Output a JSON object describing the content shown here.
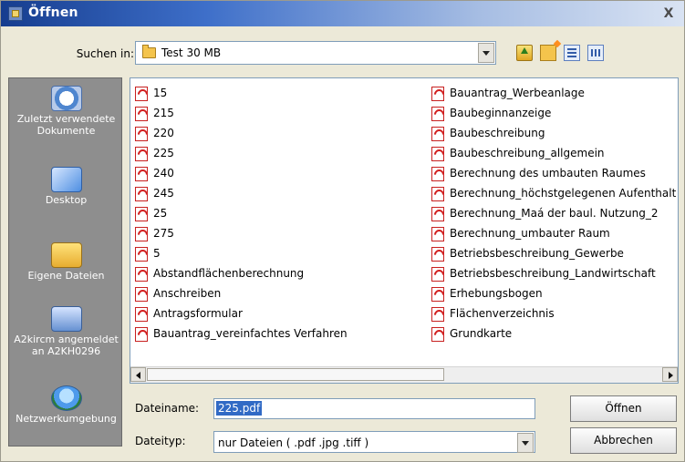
{
  "window": {
    "title": "Öffnen",
    "close": "X"
  },
  "lookin": {
    "label": "Suchen in:",
    "value": "Test 30 MB"
  },
  "places": [
    {
      "label": "Zuletzt verwendete Dokumente",
      "icon": "recent-documents-icon"
    },
    {
      "label": "Desktop",
      "icon": "desktop-icon"
    },
    {
      "label": "Eigene Dateien",
      "icon": "my-documents-icon"
    },
    {
      "label": "A2kircm angemeldet an A2KH0296",
      "icon": "computer-icon"
    },
    {
      "label": "Netzwerkumgebung",
      "icon": "network-icon"
    }
  ],
  "files_left": [
    "15",
    "215",
    "220",
    "225",
    "240",
    "245",
    "25",
    "275",
    "5",
    "Abstandflächenberechnung",
    "Anschreiben",
    "Antragsformular",
    "Bauantrag_vereinfachtes Verfahren"
  ],
  "files_right": [
    "Bauantrag_Werbeanlage",
    "Baubeginnanzeige",
    "Baubeschreibung",
    "Baubeschreibung_allgemein",
    "Berechnung des umbauten Raumes",
    "Berechnung_höchstgelegenen Aufenthalt",
    "Berechnung_Maá der baul. Nutzung_2",
    "Berechnung_umbauter Raum",
    "Betriebsbeschreibung_Gewerbe",
    "Betriebsbeschreibung_Landwirtschaft",
    "Erhebungsbogen",
    "Flächenverzeichnis",
    "Grundkarte"
  ],
  "filename": {
    "label": "Dateiname:",
    "value": "225.pdf"
  },
  "filetype": {
    "label": "Dateityp:",
    "value": "nur Dateien ( .pdf .jpg .tiff )"
  },
  "buttons": {
    "open": "Öffnen",
    "cancel": "Abbrechen"
  }
}
